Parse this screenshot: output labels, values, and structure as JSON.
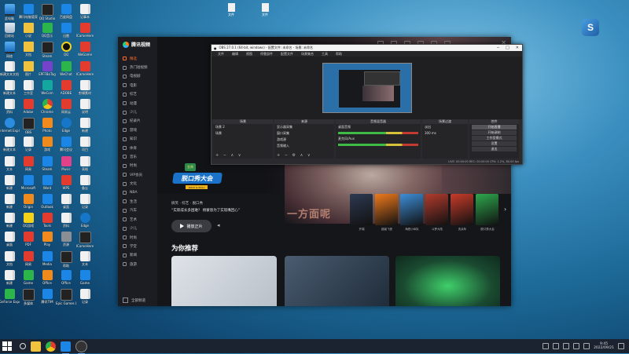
{
  "desktop": {
    "icons": [
      {
        "label": "此电脑",
        "kind": "pc"
      },
      {
        "label": "腾讯电脑管家",
        "kind": "app-blue"
      },
      {
        "label": "QQ Studio",
        "kind": "app-dark"
      },
      {
        "label": "百度网盘",
        "kind": "app-blue"
      },
      {
        "label": "记事本",
        "kind": "doc"
      },
      {
        "label": "回收站",
        "kind": "bin"
      },
      {
        "label": "小说",
        "kind": "folder"
      },
      {
        "label": "QQ音乐",
        "kind": "app-green"
      },
      {
        "label": "迅雷",
        "kind": "app-blue"
      },
      {
        "label": "ICameHere",
        "kind": "app-red"
      },
      {
        "label": "网络",
        "kind": "pc"
      },
      {
        "label": "文档",
        "kind": "folder"
      },
      {
        "label": "Steam",
        "kind": "app-dark"
      },
      {
        "label": "QQ",
        "kind": "qq"
      },
      {
        "label": "WeGame",
        "kind": "app-red"
      },
      {
        "label": "新建文本文档",
        "kind": "doc"
      },
      {
        "label": "图片",
        "kind": "folder"
      },
      {
        "label": "EPFFBoTag",
        "kind": "app-purple"
      },
      {
        "label": "WeChat",
        "kind": "app-green"
      },
      {
        "label": "ICameHere",
        "kind": "app-red"
      },
      {
        "label": "新建文本",
        "kind": "doc"
      },
      {
        "label": "工作室",
        "kind": "doc"
      },
      {
        "label": "WeCom",
        "kind": "app-teal"
      },
      {
        "label": "ADOBE",
        "kind": "app-red"
      },
      {
        "label": "剪辑素材",
        "kind": "doc"
      },
      {
        "label": "资料",
        "kind": "doc"
      },
      {
        "label": "Adobe",
        "kind": "app-red"
      },
      {
        "label": "Chrome",
        "kind": "chrome"
      },
      {
        "label": "网易云",
        "kind": "app-red"
      },
      {
        "label": "说明",
        "kind": "doc"
      },
      {
        "label": "Internet Explorer",
        "kind": "ie"
      },
      {
        "label": "OBS",
        "kind": "app-dark"
      },
      {
        "label": "Photo",
        "kind": "app-orange"
      },
      {
        "label": "Edge",
        "kind": "edge"
      },
      {
        "label": "新建",
        "kind": "doc"
      },
      {
        "label": "新建文本",
        "kind": "doc"
      },
      {
        "label": "记录",
        "kind": "doc"
      },
      {
        "label": "游戏",
        "kind": "app-orange"
      },
      {
        "label": "腾讯会议",
        "kind": "app-blue"
      },
      {
        "label": "项目",
        "kind": "doc"
      },
      {
        "label": "文本",
        "kind": "doc"
      },
      {
        "label": "网易",
        "kind": "app-red"
      },
      {
        "label": "Steam",
        "kind": "app-blue"
      },
      {
        "label": "Music",
        "kind": "app-pink"
      },
      {
        "label": "表格",
        "kind": "doc"
      },
      {
        "label": "新建",
        "kind": "doc"
      },
      {
        "label": "Microsoft",
        "kind": "app-blue"
      },
      {
        "label": "Word",
        "kind": "app-blue"
      },
      {
        "label": "WPS",
        "kind": "app-red"
      },
      {
        "label": "备忘",
        "kind": "doc"
      },
      {
        "label": "新建",
        "kind": "doc"
      },
      {
        "label": "Origin",
        "kind": "app-orange"
      },
      {
        "label": "Outlook",
        "kind": "app-blue"
      },
      {
        "label": "桌面",
        "kind": "doc"
      },
      {
        "label": "记录",
        "kind": "doc"
      },
      {
        "label": "新建",
        "kind": "doc"
      },
      {
        "label": "QQ游戏",
        "kind": "app-yellow"
      },
      {
        "label": "Tools",
        "kind": "app-red"
      },
      {
        "label": "资料",
        "kind": "doc"
      },
      {
        "label": "Edge",
        "kind": "edge"
      },
      {
        "label": "桌面",
        "kind": "doc"
      },
      {
        "label": "PDF",
        "kind": "app-red"
      },
      {
        "label": "Play",
        "kind": "app-orange"
      },
      {
        "label": "资源",
        "kind": "app-gray"
      },
      {
        "label": "ICameHere",
        "kind": "app-dark"
      },
      {
        "label": "文档",
        "kind": "doc"
      },
      {
        "label": "网易",
        "kind": "app-red"
      },
      {
        "label": "Media",
        "kind": "app-blue"
      },
      {
        "label": "帮助",
        "kind": "app-dark"
      },
      {
        "label": "文本",
        "kind": "doc"
      },
      {
        "label": "新建",
        "kind": "doc"
      },
      {
        "label": "Game",
        "kind": "app-green"
      },
      {
        "label": "Office",
        "kind": "app-orange"
      },
      {
        "label": "Office",
        "kind": "app-blue"
      },
      {
        "label": "Game",
        "kind": "app-blue"
      },
      {
        "label": "GeForce Experience",
        "kind": "app-green"
      },
      {
        "label": "多媒体",
        "kind": "app-dark"
      },
      {
        "label": "腾讯TIM",
        "kind": "app-blue"
      },
      {
        "label": "Epic Games Launcher",
        "kind": "app-dark"
      },
      {
        "label": "记录",
        "kind": "doc"
      }
    ],
    "top_files": [
      "文件",
      "文件"
    ]
  },
  "video_app": {
    "app_name": "腾讯视频",
    "nav": [
      "精选",
      "热门短视频",
      "电视剧",
      "电影",
      "综艺",
      "动漫",
      "少儿",
      "纪录片",
      "游戏",
      "知识",
      "体育",
      "音乐",
      "时尚",
      "VIP会员",
      "文化",
      "NBA",
      "生活",
      "汽车",
      "艺术",
      "少儿",
      "时尚",
      "学堂",
      "新闻",
      "旅游"
    ],
    "active_nav_index": 0,
    "bottom_item": "全部频道",
    "hero": {
      "badge": "金典",
      "show_title": "脱口秀大会",
      "show_sub": "ROCK & ROLL",
      "tags": "搞笑 · 综艺 · 脱口秀",
      "description": "“实际成长多困难？ 杨蒙恩为了实现嘴回心”",
      "overlay_text": "一方面呢",
      "play_label": "播放正片"
    },
    "posters": [
      {
        "label": "开端",
        "color": "#2d3a52"
      },
      {
        "label": "超级飞侠",
        "color": "#f07a1c"
      },
      {
        "label": "海底小纵队",
        "color": "#3d8ed8"
      },
      {
        "label": "斗罗大陆",
        "color": "#b23b2d"
      },
      {
        "label": "庆余年",
        "color": "#c93b2a"
      },
      {
        "label": "脱口秀大会",
        "color": "#2ea84d"
      }
    ],
    "rec_title": "为你推荐"
  },
  "obs": {
    "title": "OBS 27.0.1 (64-bit, windows) - 配置文件: 未命名 - 场景: 未命名",
    "menu": [
      "文件",
      "编辑",
      "视图",
      "停靠部件",
      "配置文件",
      "场景集合",
      "工具",
      "帮助"
    ],
    "docks": {
      "scenes": {
        "header": "场景",
        "items": [
          "场景 2",
          "场景"
        ]
      },
      "sources": {
        "header": "来源",
        "items": [
          "显示器采集",
          "窗口采集",
          "游戏源",
          "音频输入"
        ]
      },
      "mixer": {
        "header": "音频混音器",
        "channels": [
          "桌面音频",
          "麦克风/Aux"
        ]
      },
      "transitions": {
        "header": "场景过渡",
        "fade": "淡出",
        "duration": "300 ms"
      },
      "controls": {
        "header": "控件",
        "buttons": [
          "开始直播",
          "开始录制",
          "工作室模式",
          "设置",
          "退出"
        ]
      }
    },
    "status": "LIVE: 00:00:00   REC: 00:00:00   CPU: 1.2%, 60.00 fps"
  },
  "taskbar": {
    "time": "9:45",
    "date": "2022/09/21"
  }
}
